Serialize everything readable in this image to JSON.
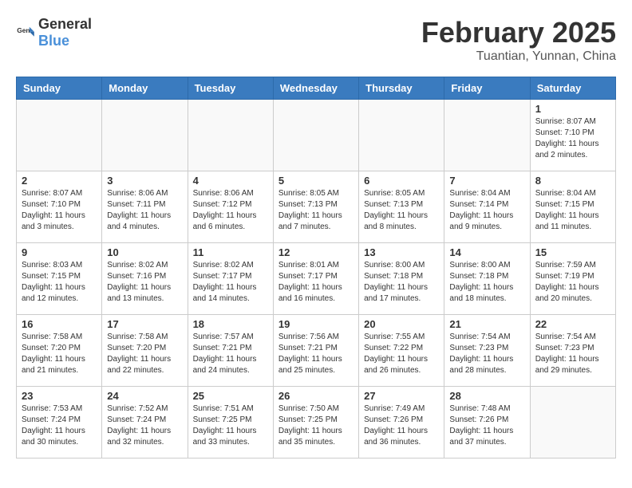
{
  "header": {
    "logo_general": "General",
    "logo_blue": "Blue",
    "month_title": "February 2025",
    "subtitle": "Tuantian, Yunnan, China"
  },
  "calendar": {
    "days_of_week": [
      "Sunday",
      "Monday",
      "Tuesday",
      "Wednesday",
      "Thursday",
      "Friday",
      "Saturday"
    ],
    "weeks": [
      [
        {
          "day": "",
          "info": ""
        },
        {
          "day": "",
          "info": ""
        },
        {
          "day": "",
          "info": ""
        },
        {
          "day": "",
          "info": ""
        },
        {
          "day": "",
          "info": ""
        },
        {
          "day": "",
          "info": ""
        },
        {
          "day": "1",
          "info": "Sunrise: 8:07 AM\nSunset: 7:10 PM\nDaylight: 11 hours\nand 2 minutes."
        }
      ],
      [
        {
          "day": "2",
          "info": "Sunrise: 8:07 AM\nSunset: 7:10 PM\nDaylight: 11 hours\nand 3 minutes."
        },
        {
          "day": "3",
          "info": "Sunrise: 8:06 AM\nSunset: 7:11 PM\nDaylight: 11 hours\nand 4 minutes."
        },
        {
          "day": "4",
          "info": "Sunrise: 8:06 AM\nSunset: 7:12 PM\nDaylight: 11 hours\nand 6 minutes."
        },
        {
          "day": "5",
          "info": "Sunrise: 8:05 AM\nSunset: 7:13 PM\nDaylight: 11 hours\nand 7 minutes."
        },
        {
          "day": "6",
          "info": "Sunrise: 8:05 AM\nSunset: 7:13 PM\nDaylight: 11 hours\nand 8 minutes."
        },
        {
          "day": "7",
          "info": "Sunrise: 8:04 AM\nSunset: 7:14 PM\nDaylight: 11 hours\nand 9 minutes."
        },
        {
          "day": "8",
          "info": "Sunrise: 8:04 AM\nSunset: 7:15 PM\nDaylight: 11 hours\nand 11 minutes."
        }
      ],
      [
        {
          "day": "9",
          "info": "Sunrise: 8:03 AM\nSunset: 7:15 PM\nDaylight: 11 hours\nand 12 minutes."
        },
        {
          "day": "10",
          "info": "Sunrise: 8:02 AM\nSunset: 7:16 PM\nDaylight: 11 hours\nand 13 minutes."
        },
        {
          "day": "11",
          "info": "Sunrise: 8:02 AM\nSunset: 7:17 PM\nDaylight: 11 hours\nand 14 minutes."
        },
        {
          "day": "12",
          "info": "Sunrise: 8:01 AM\nSunset: 7:17 PM\nDaylight: 11 hours\nand 16 minutes."
        },
        {
          "day": "13",
          "info": "Sunrise: 8:00 AM\nSunset: 7:18 PM\nDaylight: 11 hours\nand 17 minutes."
        },
        {
          "day": "14",
          "info": "Sunrise: 8:00 AM\nSunset: 7:18 PM\nDaylight: 11 hours\nand 18 minutes."
        },
        {
          "day": "15",
          "info": "Sunrise: 7:59 AM\nSunset: 7:19 PM\nDaylight: 11 hours\nand 20 minutes."
        }
      ],
      [
        {
          "day": "16",
          "info": "Sunrise: 7:58 AM\nSunset: 7:20 PM\nDaylight: 11 hours\nand 21 minutes."
        },
        {
          "day": "17",
          "info": "Sunrise: 7:58 AM\nSunset: 7:20 PM\nDaylight: 11 hours\nand 22 minutes."
        },
        {
          "day": "18",
          "info": "Sunrise: 7:57 AM\nSunset: 7:21 PM\nDaylight: 11 hours\nand 24 minutes."
        },
        {
          "day": "19",
          "info": "Sunrise: 7:56 AM\nSunset: 7:21 PM\nDaylight: 11 hours\nand 25 minutes."
        },
        {
          "day": "20",
          "info": "Sunrise: 7:55 AM\nSunset: 7:22 PM\nDaylight: 11 hours\nand 26 minutes."
        },
        {
          "day": "21",
          "info": "Sunrise: 7:54 AM\nSunset: 7:23 PM\nDaylight: 11 hours\nand 28 minutes."
        },
        {
          "day": "22",
          "info": "Sunrise: 7:54 AM\nSunset: 7:23 PM\nDaylight: 11 hours\nand 29 minutes."
        }
      ],
      [
        {
          "day": "23",
          "info": "Sunrise: 7:53 AM\nSunset: 7:24 PM\nDaylight: 11 hours\nand 30 minutes."
        },
        {
          "day": "24",
          "info": "Sunrise: 7:52 AM\nSunset: 7:24 PM\nDaylight: 11 hours\nand 32 minutes."
        },
        {
          "day": "25",
          "info": "Sunrise: 7:51 AM\nSunset: 7:25 PM\nDaylight: 11 hours\nand 33 minutes."
        },
        {
          "day": "26",
          "info": "Sunrise: 7:50 AM\nSunset: 7:25 PM\nDaylight: 11 hours\nand 35 minutes."
        },
        {
          "day": "27",
          "info": "Sunrise: 7:49 AM\nSunset: 7:26 PM\nDaylight: 11 hours\nand 36 minutes."
        },
        {
          "day": "28",
          "info": "Sunrise: 7:48 AM\nSunset: 7:26 PM\nDaylight: 11 hours\nand 37 minutes."
        },
        {
          "day": "",
          "info": ""
        }
      ]
    ]
  }
}
